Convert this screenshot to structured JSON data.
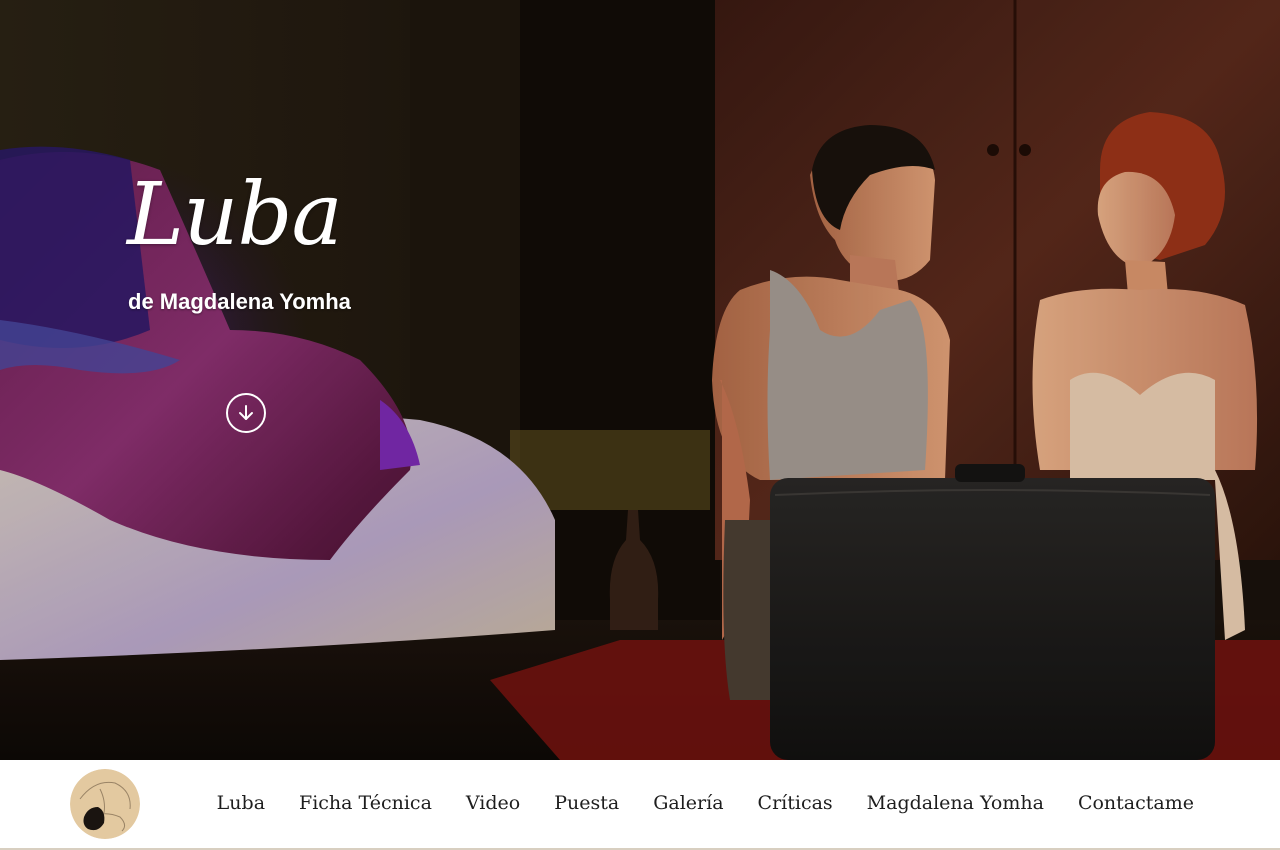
{
  "hero": {
    "title": "Luba",
    "subtitle": "de Magdalena Yomha",
    "scroll_icon": "arrow-down-circle-icon",
    "image": "theatre-stage-photo"
  },
  "nav": {
    "logo_icon": "luba-logo",
    "items": [
      {
        "label": "Luba"
      },
      {
        "label": "Ficha Técnica"
      },
      {
        "label": "Video"
      },
      {
        "label": "Puesta"
      },
      {
        "label": "Galería"
      },
      {
        "label": "Críticas"
      },
      {
        "label": "Magdalena Yomha"
      },
      {
        "label": "Contactame"
      }
    ]
  },
  "colors": {
    "nav_background": "#ffffff",
    "nav_text": "#1e1e1e",
    "hero_text": "#ffffff",
    "logo_background": "#e3c9a0"
  }
}
